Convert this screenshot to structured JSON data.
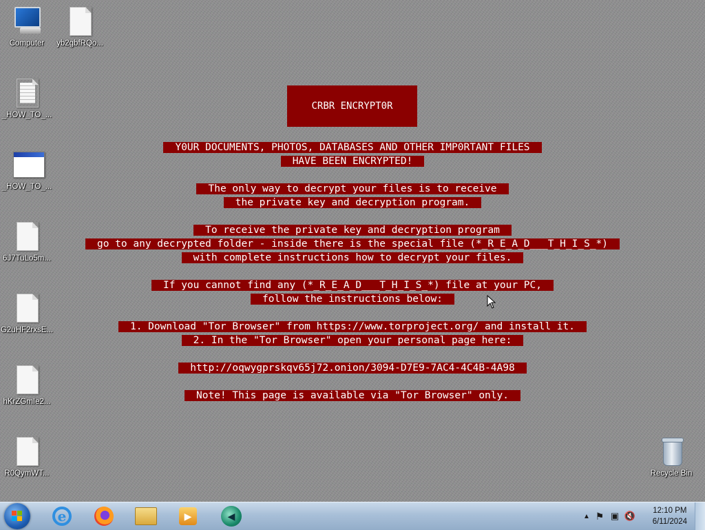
{
  "desktop": {
    "icons": [
      {
        "label": "Computer",
        "icon": "computer-icon"
      },
      {
        "label": "yb2gbfRQo...",
        "icon": "file-icon"
      },
      {
        "label": "_HOW_TO_...",
        "icon": "text-document-icon"
      },
      {
        "label": "_HOW_TO_...",
        "icon": "html-document-icon"
      },
      {
        "label": "6J7TuLo5m...",
        "icon": "file-icon"
      },
      {
        "label": "G2uHF2rxsE...",
        "icon": "file-icon"
      },
      {
        "label": "hKrZGmIe2...",
        "icon": "file-icon"
      },
      {
        "label": "R0QymWT...",
        "icon": "file-icon"
      },
      {
        "label": "Recycle Bin",
        "icon": "recycle-bin-icon"
      }
    ]
  },
  "ransom_note": {
    "title": "CRBR ENCRYPT0R",
    "lines": [
      "Y0UR DOCUMENTS, PHOTOS, DATABASES AND OTHER IMP0RTANT FILES",
      "HAVE BEEN ENCRYPTED!",
      "The only way to decrypt your files is to receive",
      "the private key and decryption program.",
      "To receive the private key and decryption program",
      "go to any decrypted folder - inside there is the special file (*_R_E_A_D___T_H_I_S_*)",
      "with complete instructions how to decrypt your files.",
      "If you cannot find any (*_R_E_A_D___T_H_I_S_*) file at your PC,",
      "follow the instructions below:",
      "1. Download \"Tor Browser\" from https://www.torproject.org/ and install it.",
      "2. In the \"Tor Browser\" open your personal page here:",
      "http://oqwygprskqv65j72.onion/3094-D7E9-7AC4-4C4B-4A98",
      "Note! This page is available via \"Tor Browser\" only."
    ],
    "background_color": "#8b0000",
    "text_color": "#ffffff"
  },
  "taskbar": {
    "apps": [
      {
        "name": "start-button",
        "icon": "windows-logo-icon"
      },
      {
        "name": "internet-explorer",
        "icon": "internet-explorer-icon"
      },
      {
        "name": "firefox",
        "icon": "firefox-icon"
      },
      {
        "name": "file-explorer",
        "icon": "folder-icon"
      },
      {
        "name": "media-player",
        "icon": "media-player-icon"
      },
      {
        "name": "app-green",
        "icon": "green-app-icon"
      }
    ],
    "tray_icons": [
      "show-hidden-icons-icon",
      "action-center-flag-icon",
      "network-icon",
      "volume-muted-icon"
    ],
    "clock": {
      "time": "12:10 PM",
      "date": "6/11/2024"
    }
  }
}
